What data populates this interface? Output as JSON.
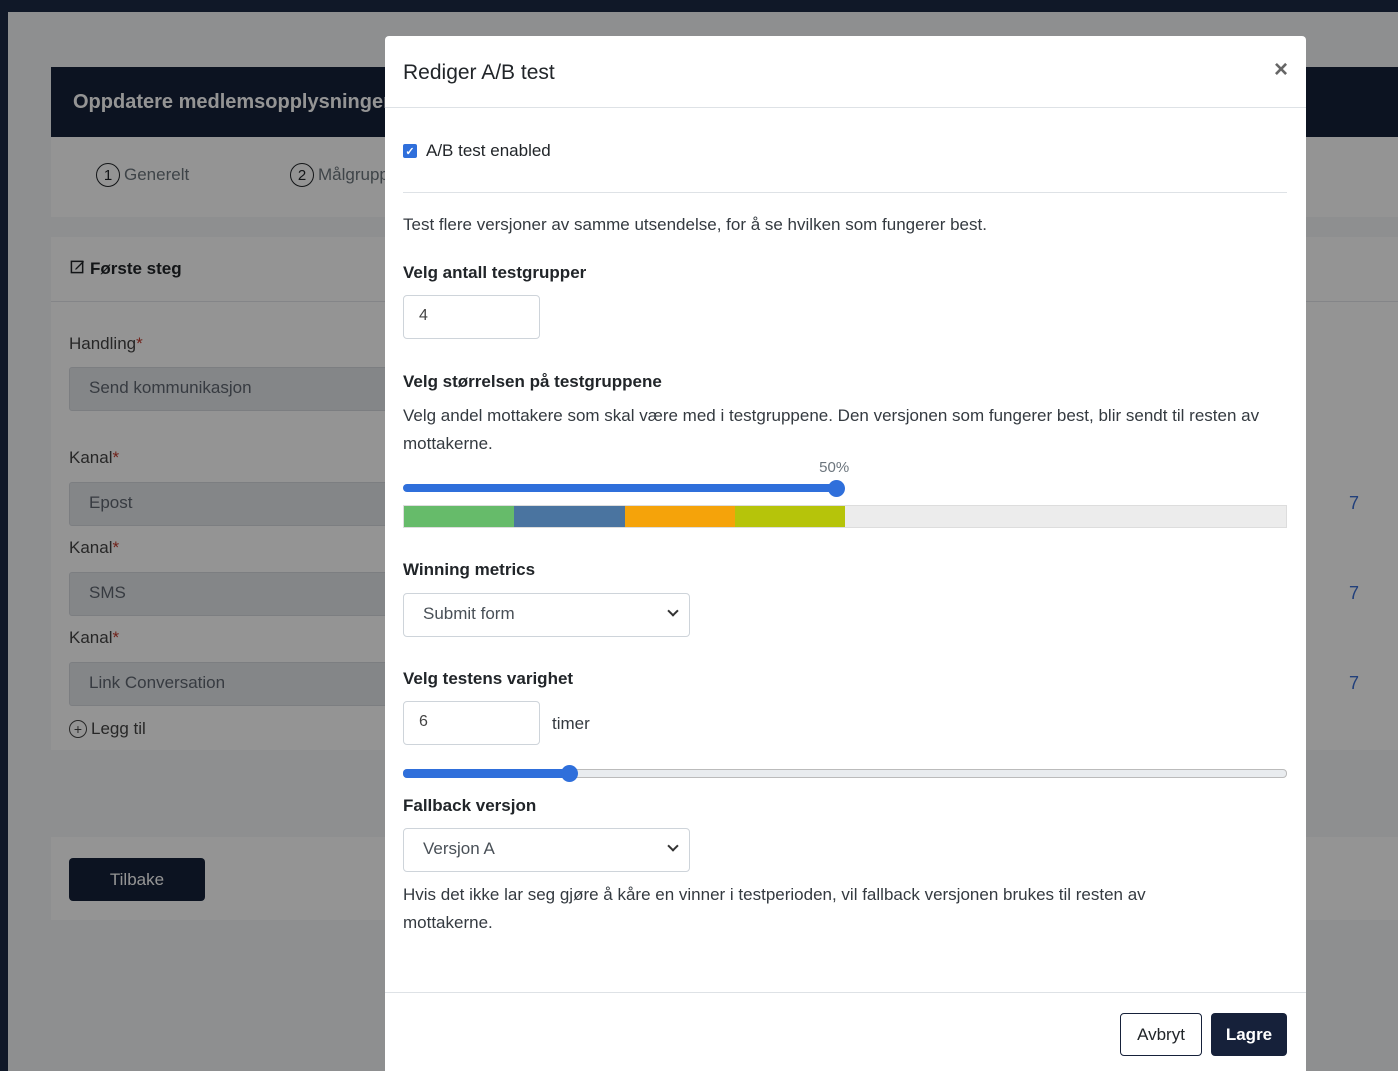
{
  "background": {
    "header_title": "Oppdatere medlemsopplysninger",
    "steps": [
      {
        "num": "1",
        "label": "Generelt"
      },
      {
        "num": "2",
        "label": "Målgruppe"
      }
    ],
    "card_title": "Første steg",
    "fields": [
      {
        "label": "Handling",
        "value": "Send kommunikasjon"
      },
      {
        "label": "Kanal",
        "value": "Epost"
      },
      {
        "label": "Kanal",
        "value": "SMS"
      },
      {
        "label": "Kanal",
        "value": "Link Conversation"
      }
    ],
    "required_mark": "*",
    "add_label": "Legg til",
    "back_button": "Tilbake",
    "edge_glyph": "7"
  },
  "modal": {
    "title": "Rediger A/B test",
    "close_glyph": "×",
    "checkbox_label": "A/B test enabled",
    "checkbox_checked": true,
    "intro": "Test flere versjoner av samme utsendelse, for å se hvilken som fungerer best.",
    "groups_label": "Velg antall testgrupper",
    "groups_value": "4",
    "size_label": "Velg størrelsen på testgruppene",
    "size_help": "Velg andel mottakere som skal være med i testgruppene. Den versjonen som fungerer best, blir sendt til resten av mottakerne.",
    "size_percent_label": "50%",
    "size_percent": 49,
    "groups_colors": [
      "#66bb6a",
      "#4a74a0",
      "#f5a30a",
      "#b6c40a"
    ],
    "group_share_percent": 12.5,
    "metrics_label": "Winning metrics",
    "metrics_value": "Submit form",
    "duration_label": "Velg testens varighet",
    "duration_value": "6",
    "duration_unit": "timer",
    "duration_fraction": 0.188,
    "fallback_label": "Fallback versjon",
    "fallback_value": "Versjon A",
    "fallback_help": "Hvis det ikke lar seg gjøre å kåre en vinner i testperioden, vil fallback versjonen brukes til resten av mottakerne.",
    "cancel_button": "Avbryt",
    "save_button": "Lagre",
    "accent_color": "#2f6fdb"
  }
}
